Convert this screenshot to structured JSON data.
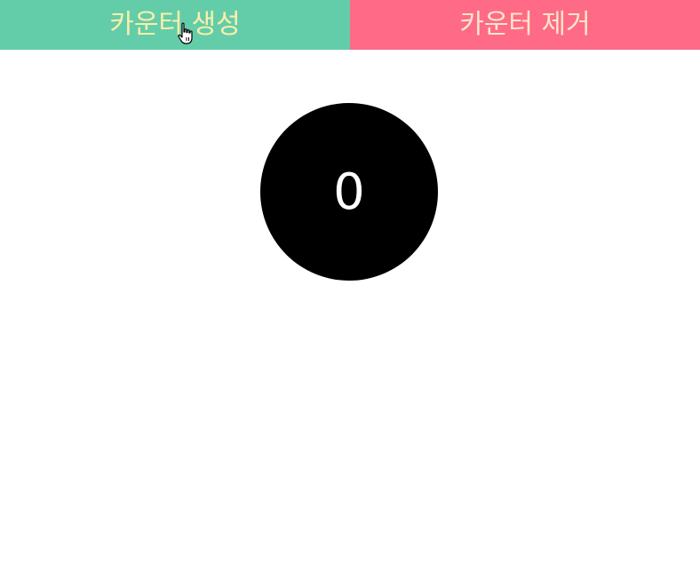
{
  "toolbar": {
    "create_label": "카운터 생성",
    "remove_label": "카운터 제거"
  },
  "counters": [
    {
      "value": "0"
    }
  ],
  "colors": {
    "create_bg": "#63cda9",
    "create_text": "#fbeeab",
    "remove_bg": "#ff6a87",
    "remove_text": "#fbe7c9",
    "counter_bg": "#000000",
    "counter_text": "#ffffff"
  },
  "icons": {
    "cursor": "hand-pointer-cursor-icon"
  }
}
